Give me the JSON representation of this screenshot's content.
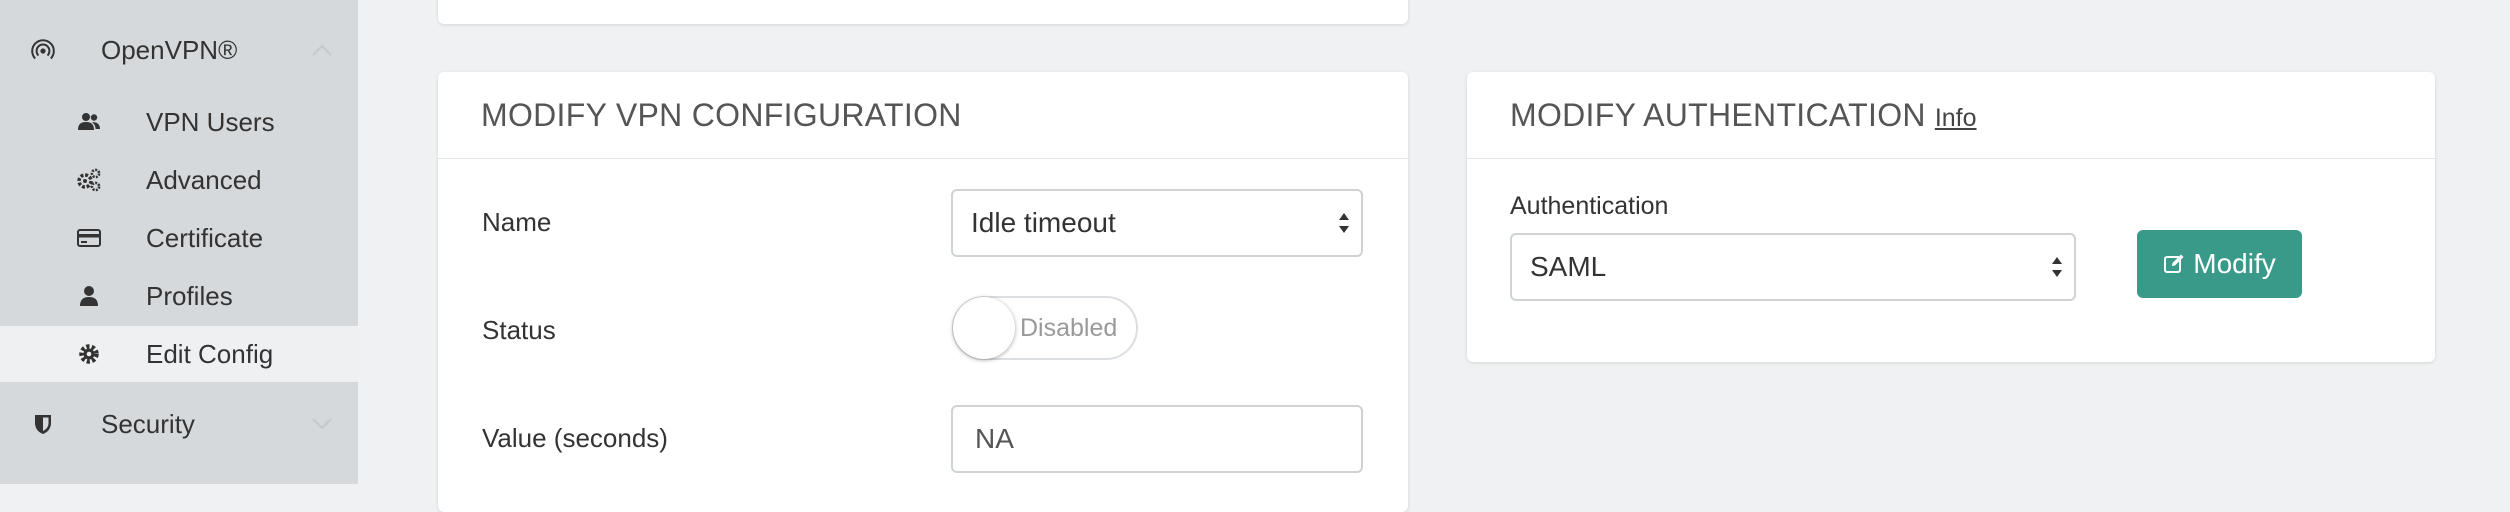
{
  "sidebar": {
    "groups": [
      {
        "label": "OpenVPN®",
        "icon": "broadcast-icon"
      },
      {
        "label": "Security",
        "icon": "shield-icon"
      }
    ],
    "items": [
      {
        "label": "VPN Users",
        "icon": "users-icon"
      },
      {
        "label": "Advanced",
        "icon": "gears-icon"
      },
      {
        "label": "Certificate",
        "icon": "credit-card-icon"
      },
      {
        "label": "Profiles",
        "icon": "user-icon"
      },
      {
        "label": "Edit Config",
        "icon": "gear-icon",
        "active": true
      }
    ]
  },
  "vpn_config": {
    "title": "MODIFY VPN CONFIGURATION",
    "name_label": "Name",
    "name_value": "Idle timeout",
    "status_label": "Status",
    "status_value": "Disabled",
    "value_label": "Value (seconds)",
    "value_value": "NA"
  },
  "auth": {
    "title": "MODIFY AUTHENTICATION",
    "info_link": "Info",
    "auth_label": "Authentication",
    "auth_value": "SAML",
    "modify_button": "Modify"
  },
  "colors": {
    "accent": "#3a9a8a",
    "sidebar_bg": "#d6d9db",
    "page_bg": "#f0f1f2"
  }
}
